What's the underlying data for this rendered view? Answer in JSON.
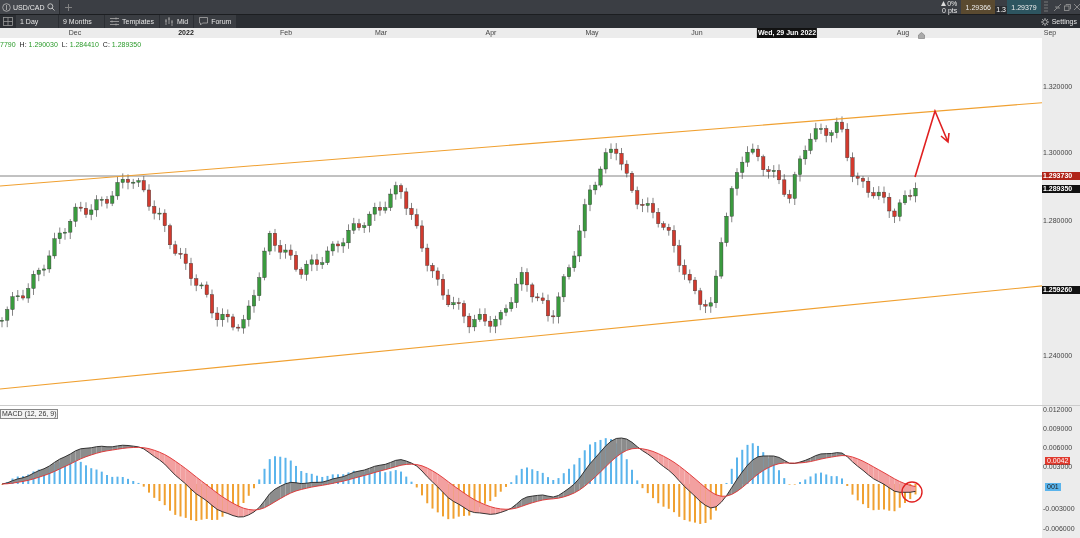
{
  "window": {
    "tab": "USD/CAD"
  },
  "quote": {
    "change": "0%",
    "points": "0 pts",
    "sell": "1.29366",
    "spread": "1.3",
    "buy": "1.29379"
  },
  "toolbar": {
    "interval": "1 Day",
    "range": "9 Months",
    "buttons": [
      {
        "label": "Templates",
        "kind": "templates"
      },
      {
        "label": "Mid",
        "kind": "mid"
      },
      {
        "label": "Forum",
        "kind": "forum"
      }
    ],
    "settings": "Settings"
  },
  "time_axis": [
    {
      "text": "Dec",
      "kind": "month"
    },
    {
      "text": "2022",
      "kind": "year"
    },
    {
      "text": "Feb",
      "kind": "month"
    },
    {
      "text": "Mar",
      "kind": "month"
    },
    {
      "text": "Apr",
      "kind": "month"
    },
    {
      "text": "May",
      "kind": "month"
    },
    {
      "text": "Jun",
      "kind": "month"
    },
    {
      "text": "Wed, 29 Jun 2022",
      "kind": "cursor"
    },
    {
      "text": "Aug",
      "kind": "month"
    },
    {
      "text": "Sep",
      "kind": "month"
    }
  ],
  "ohlc": [
    {
      "value": "7790"
    },
    {
      "label": "H:",
      "value": "1.290030"
    },
    {
      "label": "L:",
      "value": "1.284410"
    },
    {
      "label": "C:",
      "value": "1.289350"
    }
  ],
  "price_axis": [
    {
      "text": "1.320000",
      "kind": "tick"
    },
    {
      "text": "1.300000",
      "kind": "tick"
    },
    {
      "text": "1.293730",
      "kind": "current"
    },
    {
      "text": "1.289350",
      "kind": "marker"
    },
    {
      "text": "1.280000",
      "kind": "tick"
    },
    {
      "text": "1.259260",
      "kind": "marker"
    },
    {
      "text": "1.240000",
      "kind": "tick"
    }
  ],
  "macd": {
    "title": "MACD (12, 26, 9)",
    "axis": [
      {
        "text": "0.012000",
        "kind": "tick"
      },
      {
        "text": "0.009000",
        "kind": "tick"
      },
      {
        "text": "0.006000",
        "kind": "tick"
      },
      {
        "text": "0.0042",
        "kind": "macd"
      },
      {
        "text": "0.003000",
        "kind": "tick"
      },
      {
        "text": "001",
        "kind": "signal"
      },
      {
        "text": "-0.003000",
        "kind": "tick"
      },
      {
        "text": "-0.006000",
        "kind": "tick"
      }
    ]
  }
}
